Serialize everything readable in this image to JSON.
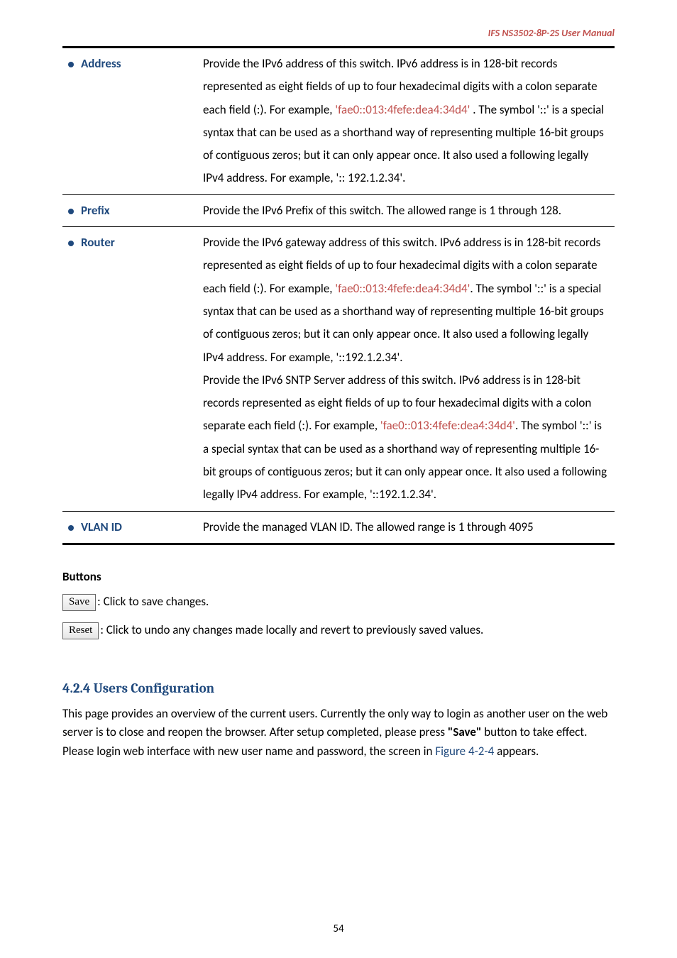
{
  "header": {
    "product_line": "IFS  NS3502-8P-2S  User  Manual"
  },
  "table": {
    "rows": [
      {
        "term": "Address",
        "body_parts": [
          "Provide the IPv6 address of this switch. IPv6 address is in 128-bit records represented as eight fields of up to four hexadecimal digits with a colon separate each field (:). For example, ",
          "'fae0::013:4fefe:dea4:34d4'",
          " . The symbol '::' is a special syntax that can be used as a shorthand way of representing multiple 16-bit groups of contiguous zeros; but it can only appear once. It also used a following legally IPv4 address. For example, ':: 192.1.2.34'."
        ]
      },
      {
        "term": "Prefix",
        "body_parts": [
          "Provide the IPv6 Prefix of this switch. The allowed range is 1 through 128."
        ]
      },
      {
        "term": "Router",
        "body_parts": [
          "Provide the IPv6 gateway address of this switch. IPv6 address is in 128-bit records represented as eight fields of up to four hexadecimal digits with a colon separate each field (:). For example, ",
          "'fae0::013:4fefe:dea4:34d4'",
          ". The symbol '::' is a special syntax that can be used as a shorthand way of representing multiple 16-bit groups of contiguous zeros; but it can only appear once. It also used a following legally IPv4 address. For example, '::192.1.2.34'.",
          "\nProvide the IPv6 SNTP Server address of this switch. IPv6 address is in 128-bit records represented as eight fields of up to four hexadecimal digits with a colon separate each field (:). For example, ",
          "'fae0::013:4fefe:dea4:34d4'",
          ". The symbol '::' is a special syntax that can be used as a shorthand way of representing multiple 16-bit groups of contiguous zeros; but it can only appear once. It also used a following legally IPv4 address. For example, '::192.1.2.34'."
        ]
      },
      {
        "term": "VLAN ID",
        "body_parts": [
          "Provide the managed VLAN ID. The allowed range is 1 through 4095"
        ]
      }
    ]
  },
  "buttons_section": {
    "heading": "Buttons",
    "save": {
      "label": "Save",
      "desc": ": Click to save changes."
    },
    "reset": {
      "label": "Reset",
      "desc": ": Click to undo any changes made locally and revert to previously saved values."
    }
  },
  "config_section": {
    "heading": "4.2.4 Users Configuration",
    "para_parts": [
      "This page provides an overview of the current users. Currently the only way to login as another user on the web server is to close and reopen the browser. After setup completed, please press ",
      "\"Save\"",
      " button to take effect. Please login web interface with new user name and password, the screen in ",
      "Figure 4-2-4",
      " appears."
    ]
  },
  "page_number": "54"
}
